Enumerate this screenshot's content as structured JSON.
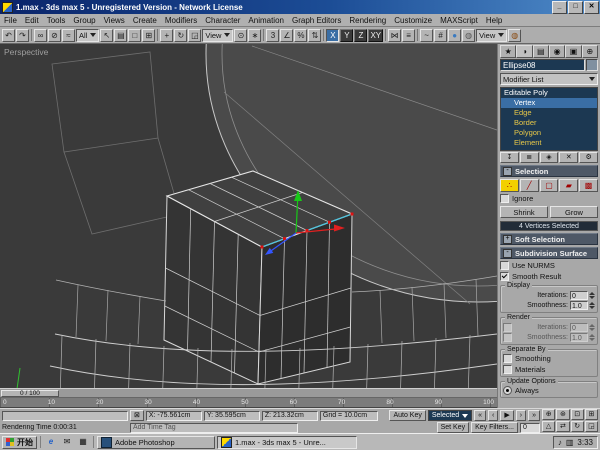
{
  "window": {
    "title": "1.max - 3ds max 5 - Unregistered Version - Network License",
    "minimize": "_",
    "maximize": "□",
    "close": "✕"
  },
  "menu": {
    "items": [
      "File",
      "Edit",
      "Tools",
      "Group",
      "Views",
      "Create",
      "Modifiers",
      "Character",
      "Animation",
      "Graph Editors",
      "Rendering",
      "Customize",
      "MAXScript",
      "Help"
    ]
  },
  "toolbar": {
    "filter_value": "All",
    "coord_value": "View",
    "render_value": "View",
    "axis": {
      "x": "X",
      "y": "Y",
      "z": "Z",
      "xy": "XY"
    },
    "icons": {
      "undo": "↶",
      "redo": "↷",
      "link": "∞",
      "unlink": "⊘",
      "bind": "≈",
      "select": "↖",
      "select_by_name": "▤",
      "region": "□",
      "crossing": "⊞",
      "move": "+",
      "rotate": "↻",
      "scale": "◲",
      "center": "⊙",
      "manipulate": "∗",
      "snap": "3",
      "angle_snap": "∠",
      "percent_snap": "%",
      "spinner_snap": "⇅",
      "mirror": "⋈",
      "align": "≡",
      "curve_editor": "~",
      "schematic": "#",
      "material_editor": "●",
      "render_scene": "◍",
      "quick_render": "◍"
    }
  },
  "viewport": {
    "label": "Perspective"
  },
  "panel": {
    "tabs": {
      "create": "★",
      "modify": "◑",
      "hierarchy": "▤",
      "motion": "◉",
      "display": "▣",
      "utilities": "⊕"
    },
    "object_name": "Ellipse08",
    "modifier_list_label": "Modifier List",
    "stack_items": [
      "Editable Poly",
      "Vertex",
      "Edge",
      "Border",
      "Polygon",
      "Element"
    ],
    "stack_buttons": {
      "pin": "↧",
      "show_end_result": "≣",
      "make_unique": "◈",
      "remove": "✕",
      "configure": "⚙"
    },
    "selection": {
      "title": "Selection",
      "collapse": "-",
      "icons": {
        "vertex": "∴",
        "edge": "╱",
        "border": "▢",
        "polygon": "▰",
        "element": "▩"
      },
      "ignore": "Ignore",
      "shrink": "Shrink",
      "grow": "Grow",
      "status": "4 Vertices Selected"
    },
    "soft_selection": {
      "title": "Soft Selection",
      "collapse": "+"
    },
    "subdivision": {
      "title": "Subdivision Surface",
      "collapse": "-",
      "use_nurms": "Use NURMS",
      "smooth_result": "Smooth Result",
      "display": "Display",
      "render": "Render",
      "iterations_label": "Iterations:",
      "smoothness_label": "Smoothness:",
      "display_iterations": "0",
      "display_smoothness": "1.0",
      "render_iterations": "0",
      "render_smoothness": "1.0",
      "separate_by": "Separate By",
      "smoothing": "Smoothing",
      "materials": "Materials",
      "update_options": "Update Options",
      "always": "Always"
    }
  },
  "timeline": {
    "slider_label": "0 / 100",
    "ticks": [
      "0",
      "10",
      "20",
      "30",
      "40",
      "50",
      "60",
      "70",
      "80",
      "90",
      "100"
    ]
  },
  "status": {
    "x": "X: -75.561cm",
    "y": "Y: 35.595cm",
    "z": "Z: 213.32cm",
    "grid": "Grid = 10.0cm",
    "prompt": "Rendering Time   0:00:31",
    "add_time_tag": "Add Time Tag",
    "auto_key": "Auto Key",
    "selected": "Selected",
    "set_key": "Set Key",
    "key_filters": "Key Filters...",
    "frame": "0",
    "icons": {
      "lock": "⊠",
      "start": "«",
      "prev": "‹",
      "play": "▶",
      "next": "›",
      "end": "»",
      "zoom": "⊕",
      "zoom_all": "⊛",
      "zoom_extents": "⊡",
      "zoom_extents_all": "⊞",
      "fov": "△",
      "pan": "⇄",
      "arc_rotate": "↻",
      "min_max": "◲"
    }
  },
  "taskbar": {
    "start": "开始",
    "quick_icons": {
      "ie": "e",
      "mail": "✉",
      "desktop": "▦"
    },
    "tasks": [
      "Adobe Photoshop",
      "1.max - 3ds max 5 - Unre..."
    ],
    "tray_icons": {
      "volume": "♪",
      "network": "▥"
    },
    "clock": "3:33"
  },
  "colors": {
    "titlebar": "#0a246a",
    "selection_highlight": "#3a6ea5",
    "stack_bg": "#1c3852",
    "subobject_yellow": "#e8c848",
    "active_level_yellow": "#f2d000",
    "vertex_red": "#e01010",
    "axis_x": "#e02020",
    "axis_y": "#18c818",
    "axis_z": "#3355ff",
    "open_edge_cyan": "#4fc3dd"
  }
}
